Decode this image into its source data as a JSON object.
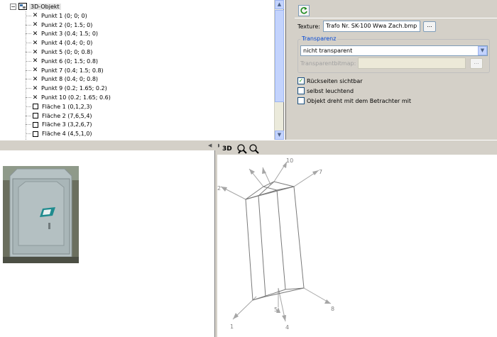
{
  "tree": {
    "root_label": "3D-Objekt",
    "expander": "−",
    "points": [
      "Punkt 1 (0; 0; 0)",
      "Punkt 2 (0; 1.5; 0)",
      "Punkt 3 (0.4; 1.5; 0)",
      "Punkt 4 (0.4; 0; 0)",
      "Punkt 5 (0; 0; 0.8)",
      "Punkt 6 (0; 1.5; 0.8)",
      "Punkt 7 (0.4; 1.5; 0.8)",
      "Punkt 8 (0.4; 0; 0.8)",
      "Punkt 9 (0.2; 1.65; 0.2)",
      "Punkt 10 (0.2; 1.65; 0.6)"
    ],
    "faces": [
      "Fläche 1 (0,1,2,3)",
      "Fläche 2 (7,6,5,4)",
      "Fläche 3 (3,2,6,7)",
      "Fläche 4 (4,5,1,0)"
    ],
    "point_marker": "✕"
  },
  "properties": {
    "refresh_icon": "refresh-icon",
    "texture_label": "Texture:",
    "texture_value": "Trafo Nr. SK-100 Wwa Zach.bmp",
    "browse_label": "...",
    "transparency_group": "Transparenz",
    "transparency_option": "nicht transparent",
    "transparent_bitmap_label": "Transparentbitmap:",
    "bitmap_browse_label": "...",
    "backface_label": "Rückseiten sichtbar",
    "backface_checked": true,
    "self_lit_label": "selbst leuchtend",
    "self_lit_checked": false,
    "billboard_label": "Objekt dreht mit dem Betrachter mit",
    "billboard_checked": false
  },
  "view3d": {
    "label": "3D",
    "point_labels": [
      "1",
      "2",
      "4",
      "5",
      "7",
      "8",
      "10"
    ]
  },
  "colors": {
    "accent": "#0046d5",
    "scroll": "#c3d3fd",
    "cabinet": "#a9b6b8"
  }
}
